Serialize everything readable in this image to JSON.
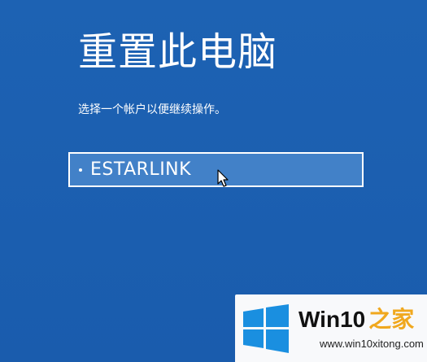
{
  "page": {
    "title": "重置此电脑",
    "subtitle": "选择一个帐户以便继续操作。"
  },
  "accounts": [
    {
      "name": "ESTARLINK",
      "selected": true
    }
  ],
  "watermark": {
    "brand_main": "Win10",
    "brand_accent": "之家",
    "url": "www.win10xitong.com",
    "logo_icon": "windows-logo-icon",
    "logo_color": "#1a8fe0",
    "accent_color": "#f0a81e"
  },
  "colors": {
    "background": "#1c5fb0",
    "tile_selected": "#4281c8",
    "text": "#ffffff"
  }
}
